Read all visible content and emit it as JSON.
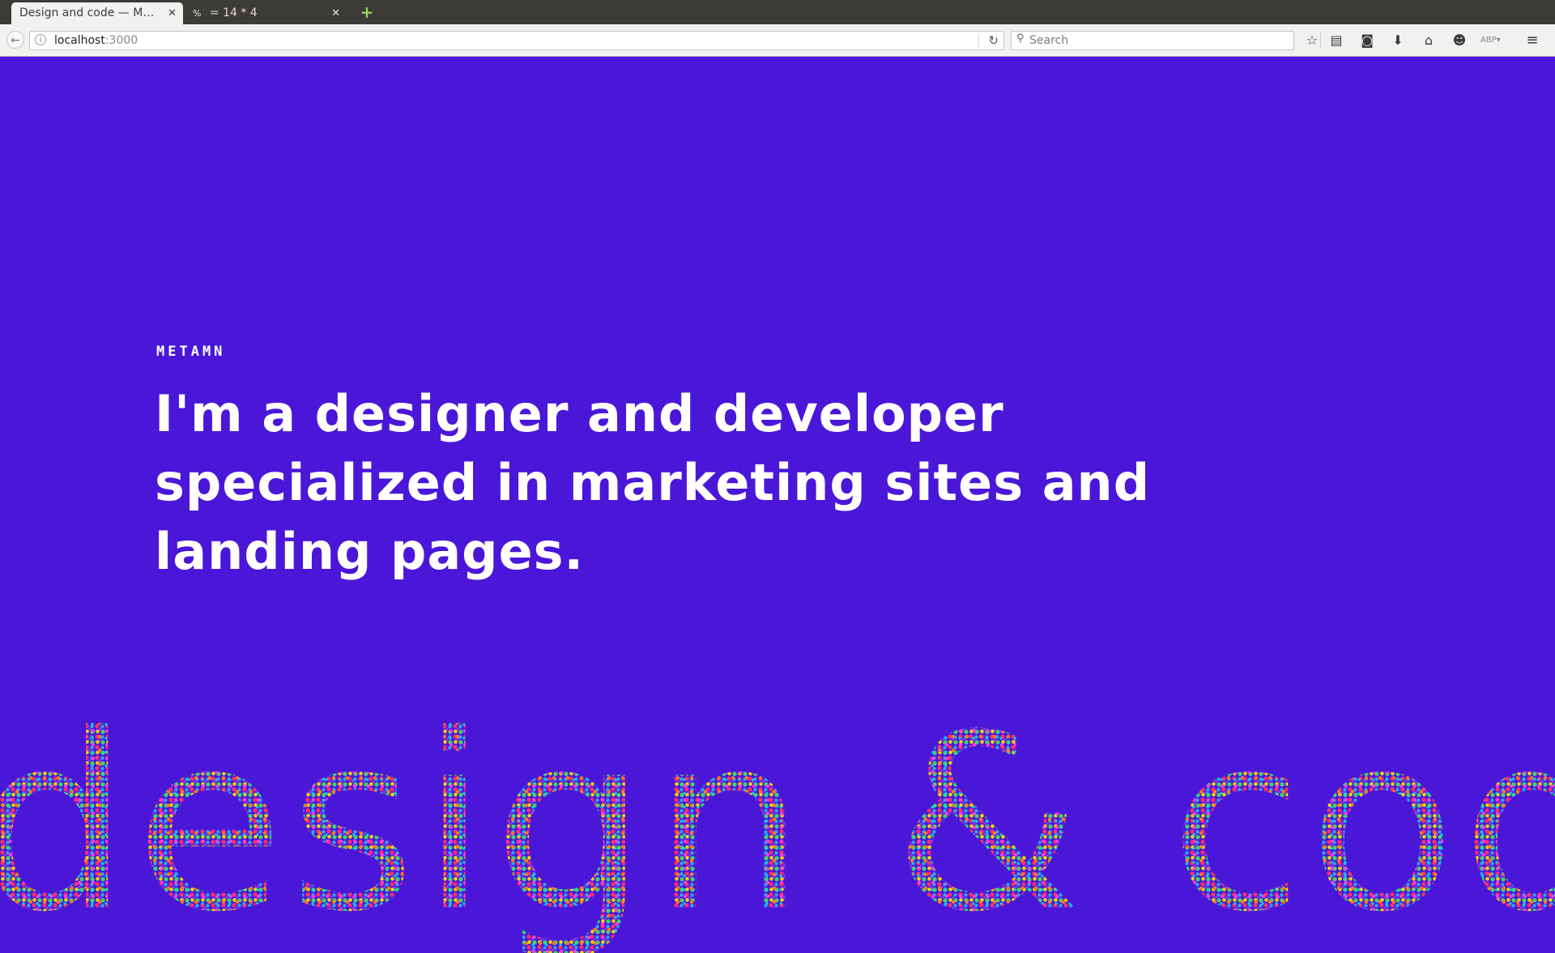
{
  "browser": {
    "tabs": [
      {
        "title": "Design and code — Met…",
        "active": true,
        "favicon": "globe-icon"
      },
      {
        "title": "= 14 * 4",
        "active": false,
        "favicon_text": "%"
      }
    ],
    "url": {
      "host": "localhost",
      "port": ":3000"
    },
    "search_placeholder": "Search",
    "toolbar_icons": [
      "star-icon",
      "reading-list-icon",
      "pocket-icon",
      "download-icon",
      "home-icon",
      "chat-icon",
      "adblock-icon",
      "menu-icon"
    ]
  },
  "page": {
    "brand": "METAMN",
    "headline": "I'm a designer and developer specialized in marketing sites and landing pages.",
    "decorative_text": "design & code",
    "background_color": "#4a17d9",
    "dot_colors": [
      "#ff2f6b",
      "#ffd400",
      "#2aa8ff",
      "#3ed07a",
      "#9b3dff",
      "#ff7a1a",
      "#ff3be0",
      "#00d6e0"
    ]
  }
}
